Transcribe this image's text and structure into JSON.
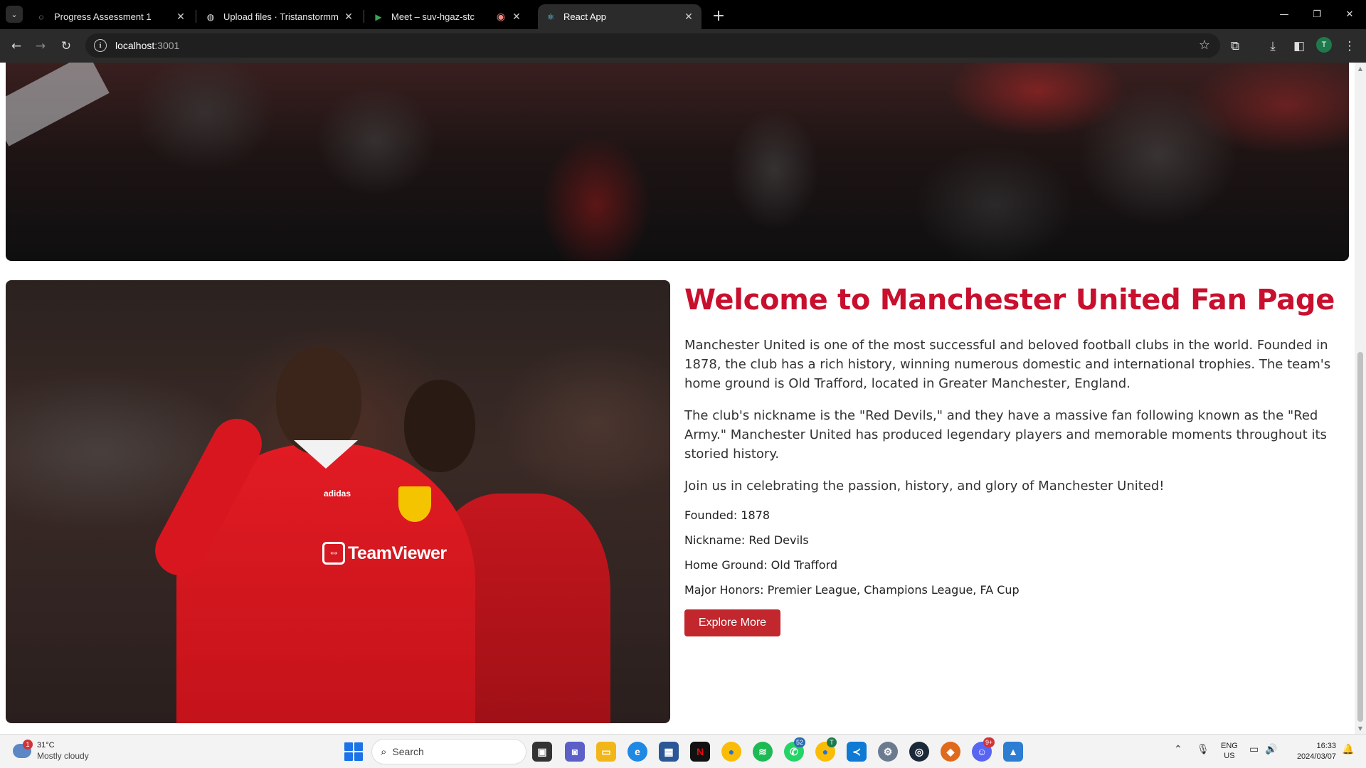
{
  "browser": {
    "tabs": [
      {
        "title": "Progress Assessment 1",
        "favicon": "loading-icon",
        "active": false
      },
      {
        "title": "Upload files · Tristanstormmm/I",
        "favicon": "github-icon",
        "active": false
      },
      {
        "title": "Meet – suv-hgaz-stc",
        "favicon": "meet-icon",
        "active": false,
        "recording": true
      },
      {
        "title": "React App",
        "favicon": "react-icon",
        "active": true
      }
    ],
    "url_host": "localhost",
    "url_port": ":3001",
    "profile_initial": "T"
  },
  "page": {
    "title": "Welcome to Manchester United Fan Page",
    "paragraphs": [
      "Manchester United is one of the most successful and beloved football clubs in the world. Founded in 1878, the club has a rich history, winning numerous domestic and international trophies. The team's home ground is Old Trafford, located in Greater Manchester, England.",
      "The club's nickname is the \"Red Devils,\" and they have a massive fan following known as the \"Red Army.\" Manchester United has produced legendary players and memorable moments throughout its storied history.",
      "Join us in celebrating the passion, history, and glory of Manchester United!"
    ],
    "facts": [
      "Founded: 1878",
      "Nickname: Red Devils",
      "Home Ground: Old Trafford",
      "Major Honors: Premier League, Champions League, FA Cup"
    ],
    "button_label": "Explore More",
    "image_sponsor": "TeamViewer",
    "image_brand": "adidas",
    "accent_color": "#c8102e",
    "button_color": "#c1272d"
  },
  "taskbar": {
    "weather_temp": "31°C",
    "weather_condition": "Mostly cloudy",
    "weather_badge": "1",
    "search_placeholder": "Search",
    "whatsapp_badge": "52",
    "chrome_badge": "T",
    "discord_badge": "9+",
    "lang_top": "ENG",
    "lang_bottom": "US",
    "time": "16:33",
    "date": "2024/03/07"
  }
}
